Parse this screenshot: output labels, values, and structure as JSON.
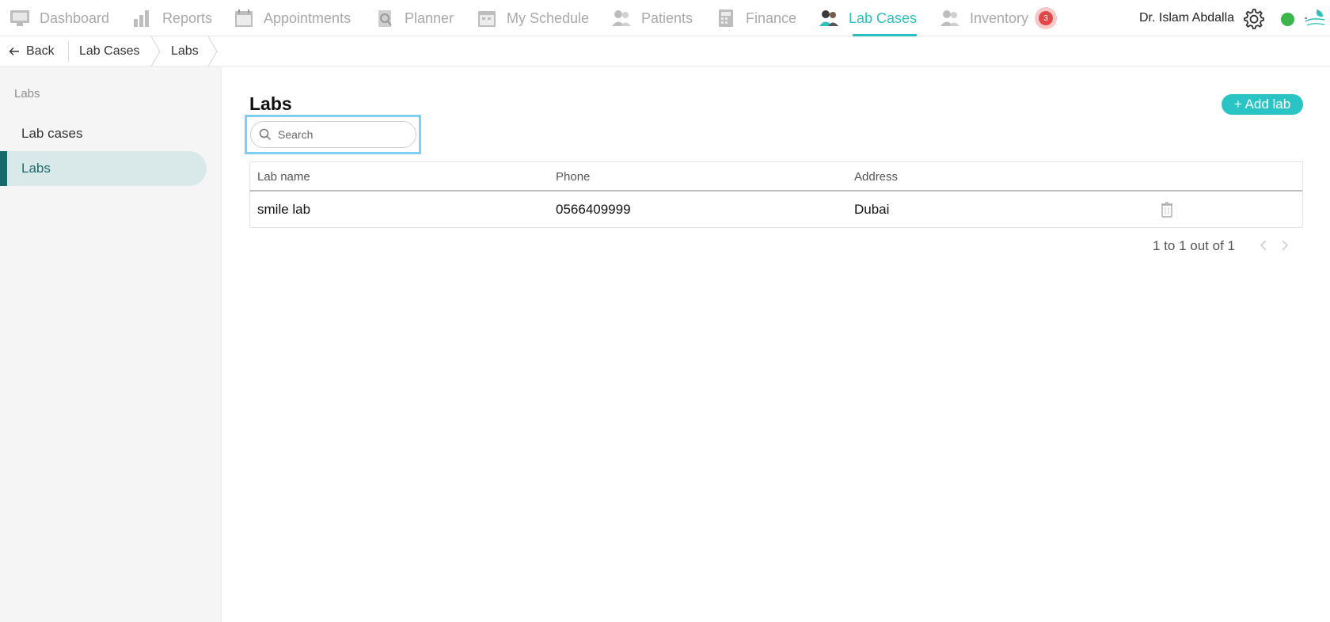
{
  "nav": {
    "items": [
      {
        "label": "Dashboard",
        "icon": "dashboard-icon"
      },
      {
        "label": "Reports",
        "icon": "reports-icon"
      },
      {
        "label": "Appointments",
        "icon": "appointments-icon"
      },
      {
        "label": "Planner",
        "icon": "planner-icon"
      },
      {
        "label": "My Schedule",
        "icon": "schedule-icon"
      },
      {
        "label": "Patients",
        "icon": "patients-icon"
      },
      {
        "label": "Finance",
        "icon": "finance-icon"
      },
      {
        "label": "Lab Cases",
        "icon": "lab-cases-icon",
        "active": true
      },
      {
        "label": "Inventory",
        "icon": "inventory-icon"
      }
    ],
    "notification_count": "3",
    "user_name": "Dr. Islam Abdalla",
    "accent_color": "#2bbfbf"
  },
  "breadcrumb": {
    "back_label": "Back",
    "items": [
      "Lab Cases",
      "Labs"
    ]
  },
  "sidebar": {
    "heading": "Labs",
    "items": [
      {
        "label": "Lab cases"
      },
      {
        "label": "Labs",
        "active": true
      }
    ]
  },
  "main": {
    "title": "Labs",
    "add_button": "+ Add lab",
    "search_placeholder": "Search",
    "search_value": "",
    "table": {
      "columns": [
        "Lab name",
        "Phone",
        "Address"
      ],
      "rows": [
        {
          "lab_name": "smile lab",
          "phone": "0566409999",
          "address": "Dubai"
        }
      ]
    },
    "pagination": "1 to 1 out of 1"
  }
}
